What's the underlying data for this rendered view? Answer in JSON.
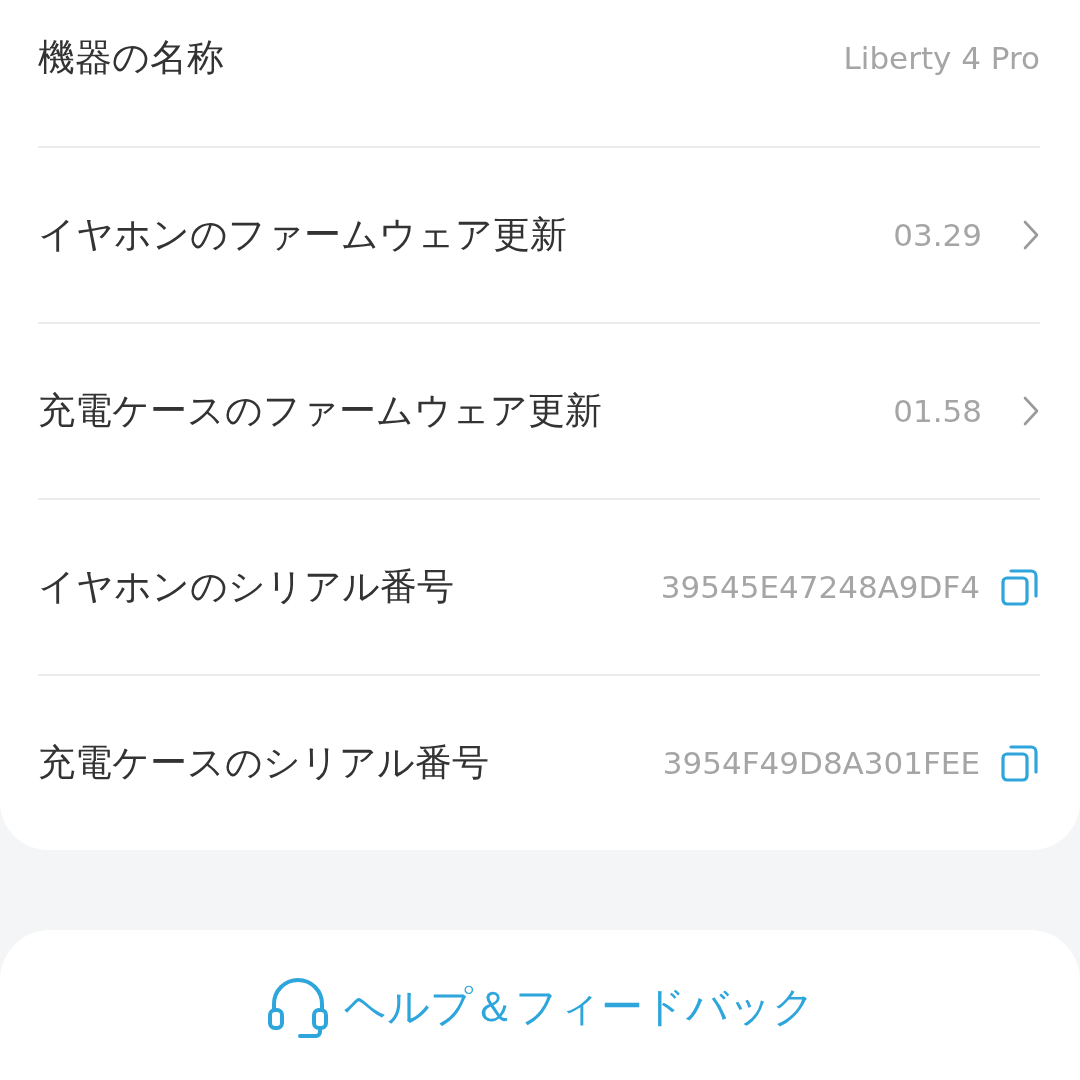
{
  "device_info": {
    "rows": [
      {
        "label": "機器の名称",
        "value": "Liberty 4 Pro",
        "kind": "text"
      },
      {
        "label": "イヤホンのファームウェア更新",
        "value": "03.29",
        "kind": "link"
      },
      {
        "label": "充電ケースのファームウェア更新",
        "value": "01.58",
        "kind": "link"
      },
      {
        "label": "イヤホンのシリアル番号",
        "value": "39545E47248A9DF4",
        "kind": "copy"
      },
      {
        "label": "充電ケースのシリアル番号",
        "value": "3954F49D8A301FEE",
        "kind": "copy"
      }
    ]
  },
  "help_button": {
    "label": "ヘルプ＆フィードバック"
  }
}
